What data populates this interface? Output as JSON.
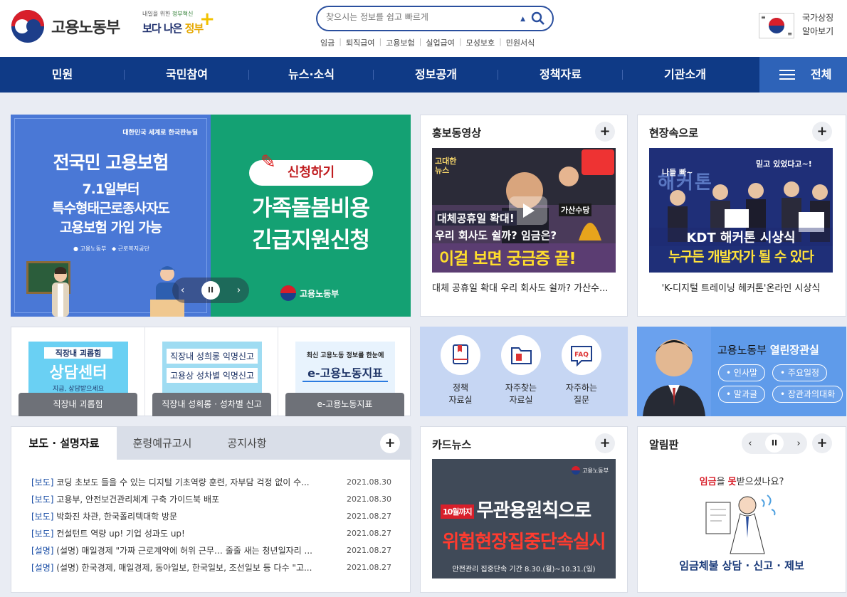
{
  "header": {
    "logo_text": "고용노동부",
    "gov_slogan_small_prefix": "내일을 위한",
    "gov_slogan_small_highlight": "정부혁신",
    "gov_slogan_big_1": "보다 나은",
    "gov_slogan_big_2": "정부",
    "search_placeholder": "찾으시는 정보를 쉽고 빠르게",
    "quick_links": [
      "임금",
      "퇴직급여",
      "고용보험",
      "실업급여",
      "모성보호",
      "민원서식"
    ],
    "national_symbol_line1": "국가상징",
    "national_symbol_line2": "알아보기"
  },
  "nav": {
    "items": [
      "민원",
      "국민참여",
      "뉴스·소식",
      "정보공개",
      "정책자료",
      "기관소개"
    ],
    "all_label": "전체"
  },
  "banner": {
    "left": {
      "org": "대한민국 세계로 한국판뉴딜",
      "title": "전국민 고용보험",
      "line1": "7.1일부터",
      "line2": "특수형태근로종사자도",
      "line3": "고용보험 가입 가능",
      "logo1": "고용노동부",
      "logo2": "근로복지공단"
    },
    "right": {
      "pill": "신청하기",
      "title1": "가족돌봄비용",
      "title2": "긴급지원신청",
      "logo": "고용노동부"
    },
    "controls": {
      "prev": "‹",
      "pause": "II",
      "next": "›"
    }
  },
  "promo_video": {
    "title": "홍보동영상",
    "plus": "+",
    "caption": "대체 공휴일 확대 우리 회사도 쉴까? 가산수...",
    "thumb_text1": "대체공휴일 확대!",
    "thumb_text2": "우리 회사도 쉴까? 임금은?",
    "thumb_text3": "이걸 보면 궁금증 끝!",
    "thumb_tag": "고대한 뉴스",
    "thumb_bubble": "가산수당"
  },
  "field": {
    "title": "현장속으로",
    "plus": "+",
    "caption": "'K-디지털 트레이닝 헤커톤'온라인 시상식",
    "thumb_text1": "KDT 해커톤 시상식",
    "thumb_text2": "누구든 개발자가 될 수 있다",
    "thumb_bg_text": "해커톤",
    "thumb_bubble1": "믿고 있었다고~!",
    "thumb_bubble2": "나들 빠~"
  },
  "quick_cells": [
    {
      "img_line1": "직장내 괴롭힘",
      "img_line2": "상담센터",
      "img_line3": "지금, 상담받으세요",
      "label": "직장내 괴롭힘"
    },
    {
      "img_line1": "직장내 성희롱 익명신고",
      "img_line2": "고용상 성차별 익명신고",
      "label": "직장내 성희롱 · 성차별 신고"
    },
    {
      "img_line1": "최신 고용노동 정보를 한눈에",
      "img_line2": "e-고용노동지표",
      "label": "e-고용노동지표"
    }
  ],
  "icon_links": [
    {
      "line1": "정책",
      "line2": "자료실",
      "icon": "book-icon"
    },
    {
      "line1": "자주찾는",
      "line2": "자료실",
      "icon": "folder-icon"
    },
    {
      "line1": "자주하는",
      "line2": "질문",
      "icon": "faq-icon"
    }
  ],
  "minister": {
    "title_normal": "고용노동부",
    "title_bold": "열린장관실",
    "chips": [
      "인사말",
      "주요일정",
      "말과글",
      "장관과의대화"
    ]
  },
  "news": {
    "tabs": [
      "보도 · 설명자료",
      "훈령예규고시",
      "공지사항"
    ],
    "plus": "+",
    "rows": [
      {
        "tag": "[보도]",
        "title": "코딩 초보도 들을 수 있는 디지털 기초역량 훈련, 자부담 걱정 없이 수...",
        "date": "2021.08.30"
      },
      {
        "tag": "[보도]",
        "title": "고용부, 안전보건관리체계 구축 가이드북 배포",
        "date": "2021.08.30"
      },
      {
        "tag": "[보도]",
        "title": "박화진 차관, 한국폴리텍대학 방문",
        "date": "2021.08.27"
      },
      {
        "tag": "[보도]",
        "title": "컨설턴트 역량 up! 기업 성과도 up!",
        "date": "2021.08.27"
      },
      {
        "tag": "[설명]",
        "title": "(설명) 매일경제 \"가짜 근로계약에 허위 근무… 줄줄 새는 청년일자리 ...",
        "date": "2021.08.27"
      },
      {
        "tag": "[설명]",
        "title": "(설명) 한국경제, 매일경제, 동아일보, 한국일보, 조선일보 등 다수 \"고...",
        "date": "2021.08.27"
      }
    ]
  },
  "card_news": {
    "title": "카드뉴스",
    "plus": "+",
    "mark": "고용노동부",
    "tag": "10월까지",
    "line1": "무관용원칙으로",
    "line2": "위험현장집중단속실시",
    "footer": "안전관리 집중단속 기간 8.30.(월)~10.31.(일)"
  },
  "notice": {
    "title": "알림판",
    "plus": "+",
    "controls": {
      "prev": "‹",
      "pause": "II",
      "next": "›"
    },
    "q_pre": "임금",
    "q_mid": "을 ",
    "q_hl": "못",
    "q_post": "받으셨나요?",
    "bottom": "임금체불 상담 · 신고 · 제보"
  },
  "colors": {
    "nav": "#0f3a86",
    "nav_all": "#2e63b8",
    "banner_left": "#4a78d6",
    "banner_right": "#14a173",
    "minister": "#5f9bea",
    "icon_panel": "#c6d6f3"
  }
}
